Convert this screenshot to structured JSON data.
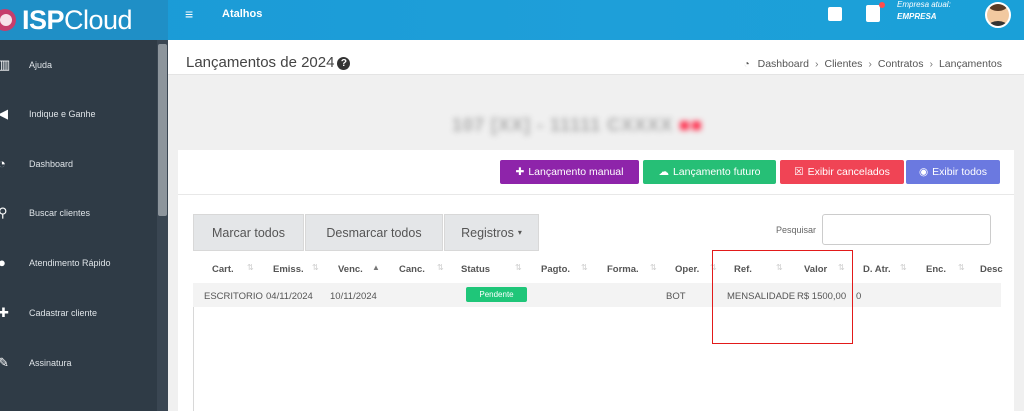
{
  "app": {
    "logo_bold": "ISP",
    "logo_regular": "Cloud",
    "menu_toggle": "≡",
    "shortcuts_label": "Atalhos",
    "company_label": "Empresa atual:",
    "company_name": "EMPRESA"
  },
  "sidebar": {
    "items": [
      {
        "label": "Ajuda",
        "icon": "book-icon"
      },
      {
        "label": "Indique e Ganhe",
        "icon": "megaphone-icon"
      },
      {
        "label": "Dashboard",
        "icon": "dashboard-icon"
      },
      {
        "label": "Buscar clientes",
        "icon": "search-icon"
      },
      {
        "label": "Atendimento Rápido",
        "icon": "users-icon"
      },
      {
        "label": "Cadastrar cliente",
        "icon": "add-user-icon"
      },
      {
        "label": "Assinatura",
        "icon": "pen-icon"
      }
    ]
  },
  "header": {
    "title": "Lançamentos de 2024",
    "breadcrumb": [
      "Dashboard",
      "Clientes",
      "Contratos",
      "Lançamentos"
    ]
  },
  "client": {
    "name_blurred": "107 [XX] - 11111 CXXXX",
    "name_tail": "■■"
  },
  "actions": {
    "manual": "Lançamento manual",
    "futuro": "Lançamento futuro",
    "cancelados": "Exibir cancelados",
    "todos": "Exibir todos"
  },
  "toolbar": {
    "marcar": "Marcar todos",
    "desmarcar": "Desmarcar todos",
    "registros": "Registros",
    "search_label": "Pesquisar"
  },
  "table": {
    "columns": [
      "Cart.",
      "Emiss.",
      "Venc.",
      "Canc.",
      "Status",
      "Pagto.",
      "Forma.",
      "Oper.",
      "Ref.",
      "Valor",
      "D. Atr.",
      "Enc.",
      "Desc"
    ],
    "rows": [
      {
        "cart": "ESCRITORIO",
        "emiss": "04/11/2024",
        "venc": "10/11/2024",
        "canc": "",
        "status": "Pendente",
        "pagto": "",
        "forma": "",
        "oper": "BOT",
        "ref": "MENSALIDADE",
        "valor": "R$ 1500,00",
        "datr": "0"
      }
    ]
  },
  "colors": {
    "topbar": "#1e9fd9",
    "sidebar": "#2f3b46",
    "btn_manual": "#8e24aa",
    "btn_futuro": "#26bf76",
    "btn_cancel": "#f04455",
    "btn_todos": "#6b79e0",
    "status_pendente": "#1fc679",
    "highlight": "#e21a1a"
  }
}
